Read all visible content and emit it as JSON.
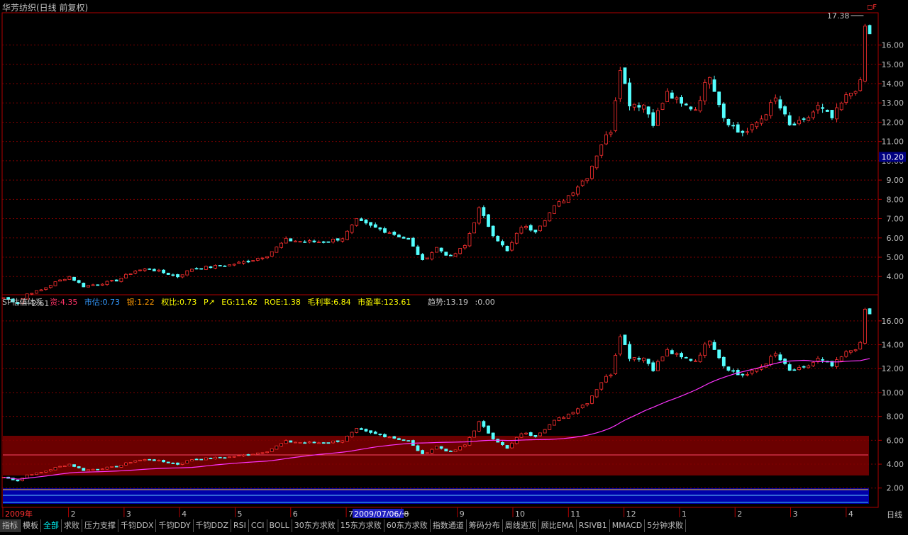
{
  "title": "华芳纺织(日线 前复权)",
  "price_panel": {
    "y_ticks": [
      "4.00",
      "5.00",
      "6.00",
      "7.00",
      "8.00",
      "9.00",
      "10.00",
      "11.00",
      "12.00",
      "13.00",
      "14.00",
      "15.00",
      "16.00"
    ],
    "current_price_label": "10.20",
    "high_label": "17.38",
    "low_label": "2.61",
    "corner_tag": "◻F"
  },
  "indicator_panel": {
    "name": "SP估值体系",
    "values": [
      {
        "label": "资:4.35",
        "color": "#ff3366"
      },
      {
        "label": "市估:0.73",
        "color": "#3399ff"
      },
      {
        "label": "银:1.22",
        "color": "#ff9900"
      },
      {
        "label": "权比:0.73",
        "color": "#ffff00"
      },
      {
        "label": "P↗",
        "color": "#ffff00"
      },
      {
        "label": "EG:11.62",
        "color": "#ffff00"
      },
      {
        "label": "ROE:1.38",
        "color": "#ffff00"
      },
      {
        "label": "毛利率:6.84",
        "color": "#ffff00"
      },
      {
        "label": "市盈率:123.61",
        "color": "#ffff00"
      },
      {
        "label": "趋势:13.19",
        "color": "#c0c0c0"
      },
      {
        "label": ":0.00",
        "color": "#c0c0c0"
      }
    ],
    "y_ticks": [
      "2.00",
      "4.00",
      "6.00",
      "8.00",
      "10.00",
      "12.00",
      "14.00",
      "16.00"
    ]
  },
  "x_axis": {
    "labels": [
      "2009年",
      "2",
      "3",
      "4",
      "5",
      "6",
      "7",
      "8",
      "9",
      "10",
      "11",
      "12",
      "1",
      "2",
      "3",
      "4"
    ],
    "cursor_label": "2009/07/06/一",
    "period": "日线"
  },
  "tabs": [
    "指标",
    "模板",
    "全部",
    "求败",
    "压力支撑",
    "千钧DDX",
    "千钧DDY",
    "千钧DDZ",
    "RSI",
    "CCI",
    "BOLL",
    "30东方求败",
    "15东方求败",
    "60东方求败",
    "指数通道",
    "筹码分布",
    "周线逃顶",
    "顾比EMA",
    "RSIVB1",
    "MMACD",
    "5分钟求败"
  ],
  "colors": {
    "up": "#ff3030",
    "down": "#54ffff",
    "ma": "#ff33ff",
    "grid": "#800000",
    "axis": "#b00000"
  },
  "chart_data": {
    "type": "candlestick",
    "series": [
      {
        "name": "华芳纺织",
        "description": "daily close path (approx)"
      }
    ],
    "x": [
      "2009-01",
      "2009-02",
      "2009-03",
      "2009-04",
      "2009-05",
      "2009-06",
      "2009-07",
      "2009-08",
      "2009-09",
      "2009-10",
      "2009-11",
      "2009-12",
      "2010-01",
      "2010-02",
      "2010-03",
      "2010-04"
    ],
    "close_path": [
      [
        0,
        2.9
      ],
      [
        3,
        2.61
      ],
      [
        5,
        3.1
      ],
      [
        8,
        3.3
      ],
      [
        11,
        3.7
      ],
      [
        14,
        4.0
      ],
      [
        17,
        3.5
      ],
      [
        20,
        3.6
      ],
      [
        24,
        3.8
      ],
      [
        28,
        4.3
      ],
      [
        31,
        4.4
      ],
      [
        34,
        4.2
      ],
      [
        37,
        4.0
      ],
      [
        40,
        4.4
      ],
      [
        44,
        4.5
      ],
      [
        48,
        4.6
      ],
      [
        52,
        4.8
      ],
      [
        56,
        5.1
      ],
      [
        60,
        5.9
      ],
      [
        64,
        5.8
      ],
      [
        68,
        5.8
      ],
      [
        72,
        6.0
      ],
      [
        75,
        6.9
      ],
      [
        78,
        6.6
      ],
      [
        82,
        6.3
      ],
      [
        86,
        5.9
      ],
      [
        89,
        4.8
      ],
      [
        92,
        5.5
      ],
      [
        95,
        5.0
      ],
      [
        98,
        5.6
      ],
      [
        101,
        7.5
      ],
      [
        104,
        6.2
      ],
      [
        107,
        5.3
      ],
      [
        110,
        6.6
      ],
      [
        113,
        6.4
      ],
      [
        117,
        7.6
      ],
      [
        120,
        8.2
      ],
      [
        124,
        9.2
      ],
      [
        127,
        10.9
      ],
      [
        129,
        11.6
      ],
      [
        131,
        14.9
      ],
      [
        133,
        13.0
      ],
      [
        136,
        12.9
      ],
      [
        138,
        12.0
      ],
      [
        141,
        13.5
      ],
      [
        144,
        12.9
      ],
      [
        147,
        12.7
      ],
      [
        150,
        14.5
      ],
      [
        153,
        12.3
      ],
      [
        156,
        11.5
      ],
      [
        158,
        11.5
      ],
      [
        161,
        12.2
      ],
      [
        164,
        13.2
      ],
      [
        167,
        11.8
      ],
      [
        170,
        12.0
      ],
      [
        173,
        12.8
      ],
      [
        176,
        12.2
      ],
      [
        179,
        13.3
      ],
      [
        182,
        14.0
      ],
      [
        183,
        17.38
      ],
      [
        184,
        16.5
      ]
    ],
    "markers": {
      "high": 17.38,
      "low": 2.61,
      "current": 10.2
    },
    "price_ylim": [
      3.2,
      17.6
    ],
    "indicator_ylim": [
      0.5,
      17.0
    ],
    "xlabel": "",
    "ylabel": ""
  }
}
